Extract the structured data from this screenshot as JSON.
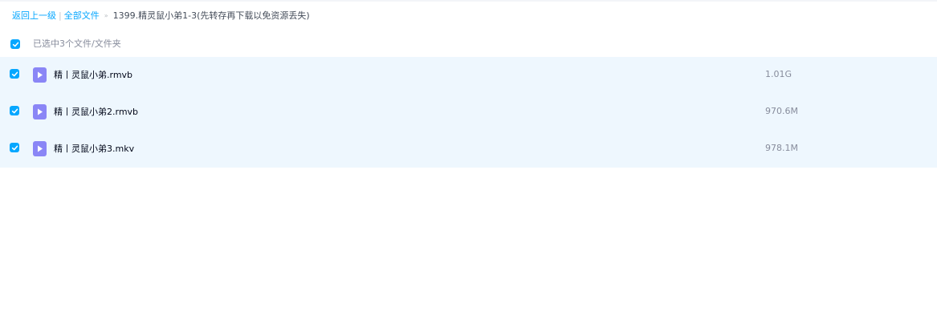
{
  "breadcrumb": {
    "back_label": "返回上一级",
    "separator": "|",
    "all_files_label": "全部文件",
    "arrow": "»",
    "current": "1399.精灵鼠小弟1-3(先转存再下载以免资源丢失)"
  },
  "selection": {
    "text": "已选中3个文件/文件夹",
    "all_checked": true
  },
  "files": [
    {
      "name": "精丨灵鼠小弟.rmvb",
      "size": "1.01G",
      "checked": true,
      "type": "video"
    },
    {
      "name": "精丨灵鼠小弟2.rmvb",
      "size": "970.6M",
      "checked": true,
      "type": "video"
    },
    {
      "name": "精丨灵鼠小弟3.mkv",
      "size": "978.1M",
      "checked": true,
      "type": "video"
    }
  ],
  "colors": {
    "accent": "#06a7ff",
    "row_selected_bg": "#eef7fe",
    "video_icon": "#8a86f6"
  }
}
